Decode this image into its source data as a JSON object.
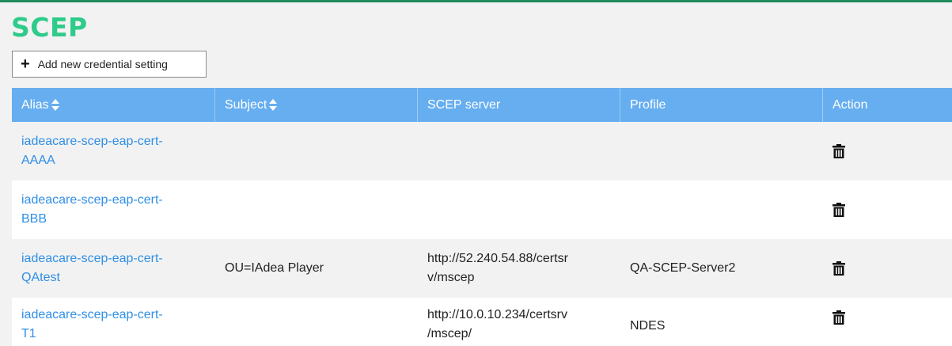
{
  "page": {
    "title": "SCEP",
    "add_button_label": "Add new credential setting",
    "accent_color": "#2ecb8a",
    "header_color": "#66aef0",
    "link_color": "#2f8fe6"
  },
  "table": {
    "headers": {
      "alias": "Alias",
      "subject": "Subject",
      "scep_server": "SCEP server",
      "profile": "Profile",
      "action": "Action"
    },
    "rows": [
      {
        "alias_line1": "iadeacare-scep-eap-cert-",
        "alias_line2": "AAAA",
        "subject": "",
        "server_line1": "",
        "server_line2": "",
        "profile": "",
        "action_icon": "trash-icon"
      },
      {
        "alias_line1": "iadeacare-scep-eap-cert-",
        "alias_line2": "BBB",
        "subject": "",
        "server_line1": "",
        "server_line2": "",
        "profile": "",
        "action_icon": "trash-icon"
      },
      {
        "alias_line1": "iadeacare-scep-eap-cert-",
        "alias_line2": "QAtest",
        "subject": "OU=IAdea Player",
        "server_line1": "http://52.240.54.88/certsr",
        "server_line2": "v/mscep",
        "profile": "QA-SCEP-Server2",
        "action_icon": "trash-icon"
      },
      {
        "alias_line1": "iadeacare-scep-eap-cert-",
        "alias_line2": "T1",
        "subject": "",
        "server_line1": "http://10.0.10.234/certsrv",
        "server_line2": "/mscep/",
        "profile": "NDES",
        "action_icon": "trash-icon"
      }
    ]
  }
}
